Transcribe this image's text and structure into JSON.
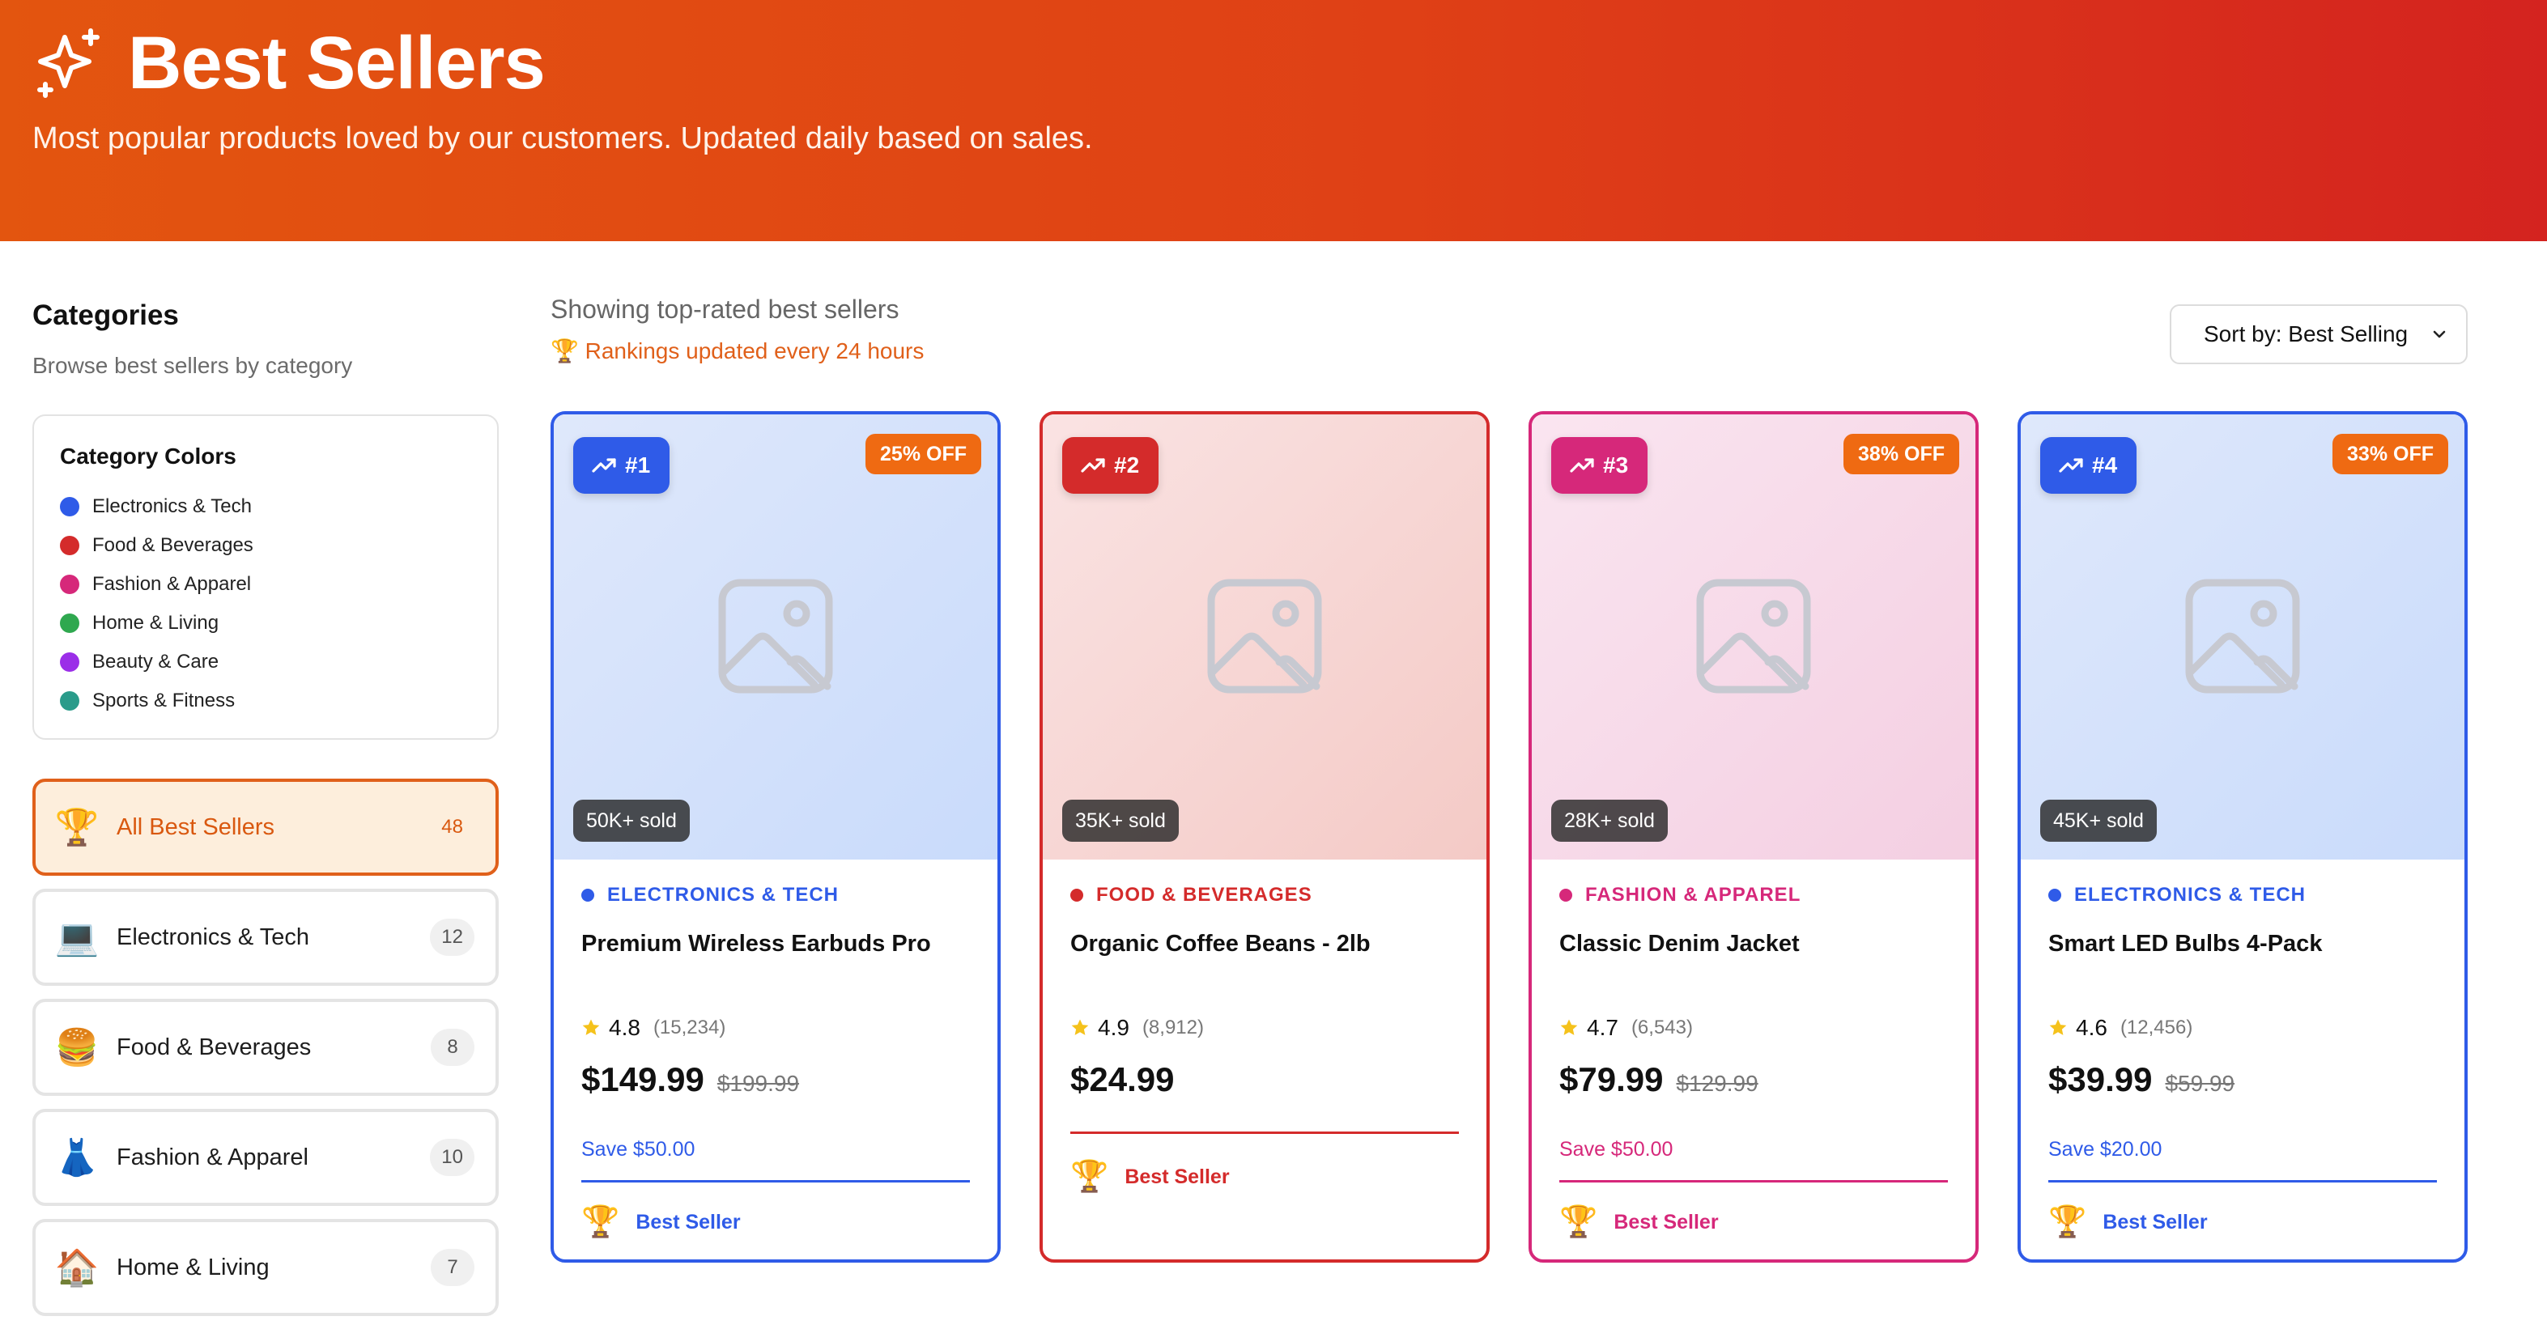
{
  "header": {
    "title": "Best Sellers",
    "subtitle": "Most popular products loved by our customers. Updated daily based on sales."
  },
  "sidebar": {
    "title": "Categories",
    "subtitle": "Browse best sellers by category",
    "legend": {
      "title": "Category Colors",
      "items": [
        {
          "label": "Electronics & Tech",
          "color": "#2f5be8"
        },
        {
          "label": "Food & Beverages",
          "color": "#d42b2b"
        },
        {
          "label": "Fashion & Apparel",
          "color": "#d6287a"
        },
        {
          "label": "Home & Living",
          "color": "#2fa84f"
        },
        {
          "label": "Beauty & Care",
          "color": "#9b2ee8"
        },
        {
          "label": "Sports & Fitness",
          "color": "#2a9b8a"
        }
      ]
    },
    "categories": [
      {
        "emoji": "🏆",
        "label": "All Best Sellers",
        "count": "48"
      },
      {
        "emoji": "💻",
        "label": "Electronics & Tech",
        "count": "12"
      },
      {
        "emoji": "🍔",
        "label": "Food & Beverages",
        "count": "8"
      },
      {
        "emoji": "👗",
        "label": "Fashion & Apparel",
        "count": "10"
      },
      {
        "emoji": "🏠",
        "label": "Home & Living",
        "count": "7"
      }
    ]
  },
  "main": {
    "showing": "Showing top-rated best sellers",
    "rank_note": "🏆 Rankings updated every 24 hours",
    "sort_label": "Sort by: Best Selling"
  },
  "products": [
    {
      "rank": "#1",
      "discount": "25% OFF",
      "sold": "50K+ sold",
      "category": "ELECTRONICS & TECH",
      "name": "Premium Wireless Earbuds Pro",
      "rating": "4.8",
      "reviews": "(15,234)",
      "price": "$149.99",
      "old_price": "$199.99",
      "save": "Save $50.00",
      "best_label": "Best Seller",
      "color": "#2f5be8",
      "bg_from": "#dfe8fb",
      "bg_to": "#c9dbfb"
    },
    {
      "rank": "#2",
      "discount": "",
      "sold": "35K+ sold",
      "category": "FOOD & BEVERAGES",
      "name": "Organic Coffee Beans - 2lb",
      "rating": "4.9",
      "reviews": "(8,912)",
      "price": "$24.99",
      "old_price": "",
      "save": "",
      "best_label": "Best Seller",
      "color": "#d42b2b",
      "bg_from": "#fae3e3",
      "bg_to": "#f4cac6"
    },
    {
      "rank": "#3",
      "discount": "38% OFF",
      "sold": "28K+ sold",
      "category": "FASHION & APPAREL",
      "name": "Classic Denim Jacket",
      "rating": "4.7",
      "reviews": "(6,543)",
      "price": "$79.99",
      "old_price": "$129.99",
      "save": "Save $50.00",
      "best_label": "Best Seller",
      "color": "#d6287a",
      "bg_from": "#fae5f0",
      "bg_to": "#f4cfe2"
    },
    {
      "rank": "#4",
      "discount": "33% OFF",
      "sold": "45K+ sold",
      "category": "ELECTRONICS & TECH",
      "name": "Smart LED Bulbs 4-Pack",
      "rating": "4.6",
      "reviews": "(12,456)",
      "price": "$39.99",
      "old_price": "$59.99",
      "save": "Save $20.00",
      "best_label": "Best Seller",
      "color": "#2f5be8",
      "bg_from": "#dfe8fb",
      "bg_to": "#c9dbfb"
    }
  ]
}
